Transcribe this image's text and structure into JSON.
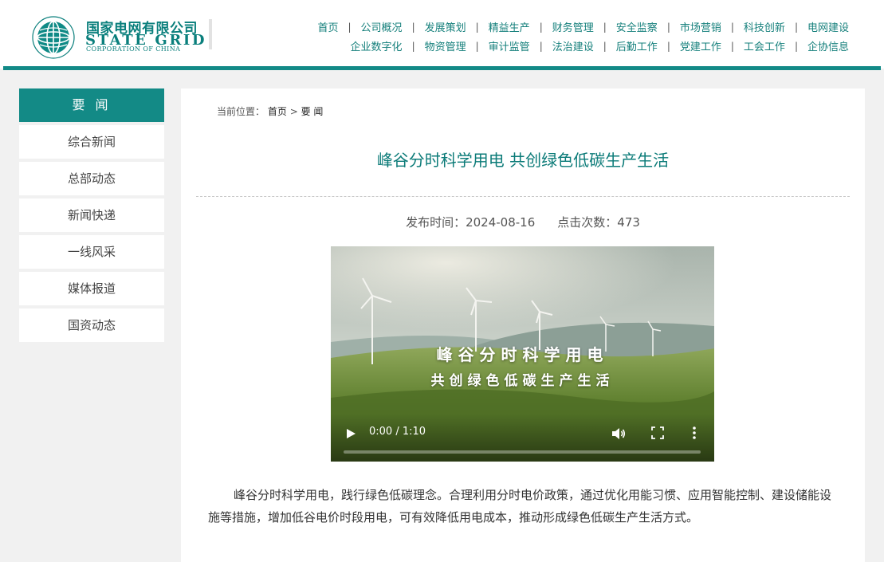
{
  "brand": {
    "name_cn": "国家电网有限公司",
    "name_en": "STATE GRID",
    "name_en_sub": "CORPORATION OF CHINA"
  },
  "nav": {
    "row1": [
      "首页",
      "公司概况",
      "发展策划",
      "精益生产",
      "财务管理",
      "安全监察",
      "市场营销",
      "科技创新",
      "电网建设"
    ],
    "row2": [
      "企业数字化",
      "物资管理",
      "审计监管",
      "法治建设",
      "后勤工作",
      "党建工作",
      "工会工作",
      "企协信息"
    ]
  },
  "sidebar": {
    "heading": "要 闻",
    "items": [
      "综合新闻",
      "总部动态",
      "新闻快递",
      "一线风采",
      "媒体报道",
      "国资动态"
    ]
  },
  "breadcrumb": {
    "label": "当前位置：",
    "home": "首页",
    "separator": ">",
    "current": "要 闻"
  },
  "article": {
    "title": "峰谷分时科学用电 共创绿色低碳生产生活",
    "publish_label": "发布时间：",
    "publish_date": "2024-08-16",
    "views_label": "点击次数：",
    "views": "473",
    "body": "峰谷分时科学用电，践行绿色低碳理念。合理利用分时电价政策，通过优化用能习惯、应用智能控制、建设储能设施等措施，增加低谷电价时段用电，可有效降低用电成本，推动形成绿色低碳生产生活方式。"
  },
  "video": {
    "overlay_line1": "峰谷分时科学用电",
    "overlay_line2": "共创绿色低碳生产生活",
    "time_display": "0:00 / 1:10",
    "progress": 0
  },
  "colors": {
    "brand_teal": "#128a87",
    "title_teal": "#0b7b78"
  }
}
